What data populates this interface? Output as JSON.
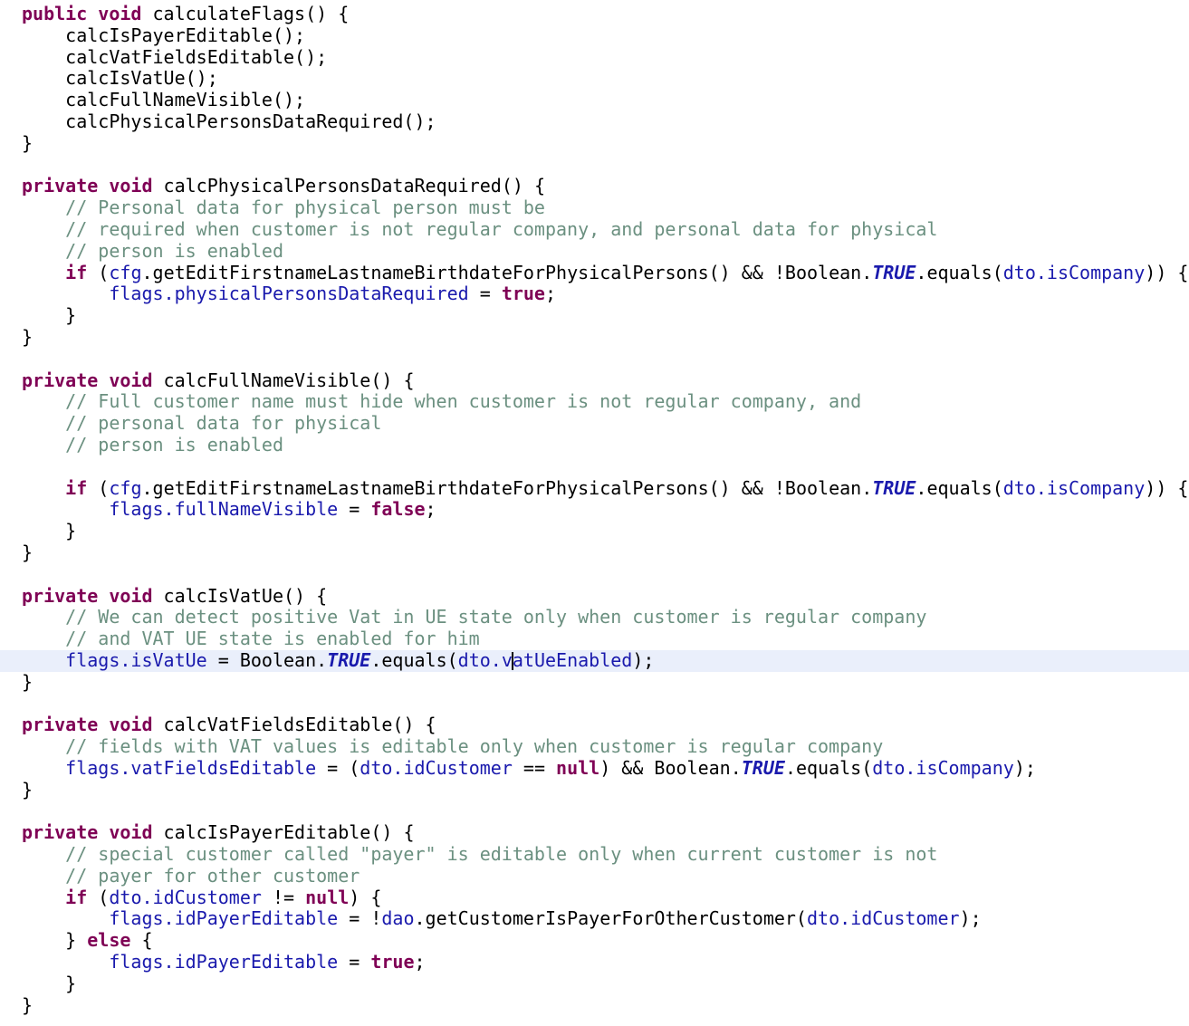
{
  "editor": {
    "language": "Java",
    "background_color": "#ffffff",
    "current_line_highlight_color": "#eaeffb",
    "caret_color": "#000000",
    "colors": {
      "plain": "#000000",
      "keyword": "#7f0055",
      "comment": "#6b9080",
      "field": "#1a1aad",
      "static_field": "#1a1aad"
    }
  },
  "code": {
    "lines": [
      {
        "current": false,
        "tokens": [
          {
            "t": "public",
            "c": "keyword"
          },
          {
            "t": " ",
            "c": "plain"
          },
          {
            "t": "void",
            "c": "keyword"
          },
          {
            "t": " calculateFlags() {",
            "c": "plain"
          }
        ]
      },
      {
        "current": false,
        "tokens": [
          {
            "t": "    calcIsPayerEditable();",
            "c": "plain"
          }
        ]
      },
      {
        "current": false,
        "tokens": [
          {
            "t": "    calcVatFieldsEditable();",
            "c": "plain"
          }
        ]
      },
      {
        "current": false,
        "tokens": [
          {
            "t": "    calcIsVatUe();",
            "c": "plain"
          }
        ]
      },
      {
        "current": false,
        "tokens": [
          {
            "t": "    calcFullNameVisible();",
            "c": "plain"
          }
        ]
      },
      {
        "current": false,
        "tokens": [
          {
            "t": "    calcPhysicalPersonsDataRequired();",
            "c": "plain"
          }
        ]
      },
      {
        "current": false,
        "tokens": [
          {
            "t": "}",
            "c": "plain"
          }
        ]
      },
      {
        "current": false,
        "tokens": []
      },
      {
        "current": false,
        "tokens": [
          {
            "t": "private",
            "c": "keyword"
          },
          {
            "t": " ",
            "c": "plain"
          },
          {
            "t": "void",
            "c": "keyword"
          },
          {
            "t": " calcPhysicalPersonsDataRequired() {",
            "c": "plain"
          }
        ]
      },
      {
        "current": false,
        "tokens": [
          {
            "t": "    // Personal data for physical person must be",
            "c": "comment"
          }
        ]
      },
      {
        "current": false,
        "tokens": [
          {
            "t": "    // required when customer is not regular company, and personal data for physical",
            "c": "comment"
          }
        ]
      },
      {
        "current": false,
        "tokens": [
          {
            "t": "    // person is enabled",
            "c": "comment"
          }
        ]
      },
      {
        "current": false,
        "tokens": [
          {
            "t": "    ",
            "c": "plain"
          },
          {
            "t": "if",
            "c": "keyword"
          },
          {
            "t": " (",
            "c": "plain"
          },
          {
            "t": "cfg",
            "c": "field"
          },
          {
            "t": ".getEditFirstnameLastnameBirthdateForPhysicalPersons() && !Boolean.",
            "c": "plain"
          },
          {
            "t": "TRUE",
            "c": "static"
          },
          {
            "t": ".equals(",
            "c": "plain"
          },
          {
            "t": "dto.isCompany",
            "c": "field"
          },
          {
            "t": ")) {",
            "c": "plain"
          }
        ]
      },
      {
        "current": false,
        "tokens": [
          {
            "t": "        ",
            "c": "plain"
          },
          {
            "t": "flags.physicalPersonsDataRequired",
            "c": "field"
          },
          {
            "t": " = ",
            "c": "plain"
          },
          {
            "t": "true",
            "c": "keyword"
          },
          {
            "t": ";",
            "c": "plain"
          }
        ]
      },
      {
        "current": false,
        "tokens": [
          {
            "t": "    }",
            "c": "plain"
          }
        ]
      },
      {
        "current": false,
        "tokens": [
          {
            "t": "}",
            "c": "plain"
          }
        ]
      },
      {
        "current": false,
        "tokens": []
      },
      {
        "current": false,
        "tokens": [
          {
            "t": "private",
            "c": "keyword"
          },
          {
            "t": " ",
            "c": "plain"
          },
          {
            "t": "void",
            "c": "keyword"
          },
          {
            "t": " calcFullNameVisible() {",
            "c": "plain"
          }
        ]
      },
      {
        "current": false,
        "tokens": [
          {
            "t": "    // Full customer name must hide when customer is not regular company, and",
            "c": "comment"
          }
        ]
      },
      {
        "current": false,
        "tokens": [
          {
            "t": "    // personal data for physical",
            "c": "comment"
          }
        ]
      },
      {
        "current": false,
        "tokens": [
          {
            "t": "    // person is enabled",
            "c": "comment"
          }
        ]
      },
      {
        "current": false,
        "tokens": []
      },
      {
        "current": false,
        "tokens": [
          {
            "t": "    ",
            "c": "plain"
          },
          {
            "t": "if",
            "c": "keyword"
          },
          {
            "t": " (",
            "c": "plain"
          },
          {
            "t": "cfg",
            "c": "field"
          },
          {
            "t": ".getEditFirstnameLastnameBirthdateForPhysicalPersons() && !Boolean.",
            "c": "plain"
          },
          {
            "t": "TRUE",
            "c": "static"
          },
          {
            "t": ".equals(",
            "c": "plain"
          },
          {
            "t": "dto.isCompany",
            "c": "field"
          },
          {
            "t": ")) {",
            "c": "plain"
          }
        ]
      },
      {
        "current": false,
        "tokens": [
          {
            "t": "        ",
            "c": "plain"
          },
          {
            "t": "flags.fullNameVisible",
            "c": "field"
          },
          {
            "t": " = ",
            "c": "plain"
          },
          {
            "t": "false",
            "c": "keyword"
          },
          {
            "t": ";",
            "c": "plain"
          }
        ]
      },
      {
        "current": false,
        "tokens": [
          {
            "t": "    }",
            "c": "plain"
          }
        ]
      },
      {
        "current": false,
        "tokens": [
          {
            "t": "}",
            "c": "plain"
          }
        ]
      },
      {
        "current": false,
        "tokens": []
      },
      {
        "current": false,
        "tokens": [
          {
            "t": "private",
            "c": "keyword"
          },
          {
            "t": " ",
            "c": "plain"
          },
          {
            "t": "void",
            "c": "keyword"
          },
          {
            "t": " calcIsVatUe() {",
            "c": "plain"
          }
        ]
      },
      {
        "current": false,
        "tokens": [
          {
            "t": "    // We can detect positive Vat in UE state only when customer is regular company",
            "c": "comment"
          }
        ]
      },
      {
        "current": false,
        "tokens": [
          {
            "t": "    // and VAT UE state is enabled for him",
            "c": "comment"
          }
        ]
      },
      {
        "current": true,
        "caret_after": 4,
        "tokens": [
          {
            "t": "    ",
            "c": "plain"
          },
          {
            "t": "flags.isVatUe",
            "c": "field"
          },
          {
            "t": " = Boolean.",
            "c": "plain"
          },
          {
            "t": "TRUE",
            "c": "static"
          },
          {
            "t": ".equals(",
            "c": "plain"
          },
          {
            "t": "dto.v",
            "c": "field"
          },
          {
            "t": "|CARET|",
            "c": "caret"
          },
          {
            "t": "atUeEnabled",
            "c": "field"
          },
          {
            "t": ");",
            "c": "plain"
          }
        ]
      },
      {
        "current": false,
        "tokens": [
          {
            "t": "}",
            "c": "plain"
          }
        ]
      },
      {
        "current": false,
        "tokens": []
      },
      {
        "current": false,
        "tokens": [
          {
            "t": "private",
            "c": "keyword"
          },
          {
            "t": " ",
            "c": "plain"
          },
          {
            "t": "void",
            "c": "keyword"
          },
          {
            "t": " calcVatFieldsEditable() {",
            "c": "plain"
          }
        ]
      },
      {
        "current": false,
        "tokens": [
          {
            "t": "    // fields with VAT values is editable only when customer is regular company",
            "c": "comment"
          }
        ]
      },
      {
        "current": false,
        "tokens": [
          {
            "t": "    ",
            "c": "plain"
          },
          {
            "t": "flags.vatFieldsEditable",
            "c": "field"
          },
          {
            "t": " = (",
            "c": "plain"
          },
          {
            "t": "dto.idCustomer",
            "c": "field"
          },
          {
            "t": " == ",
            "c": "plain"
          },
          {
            "t": "null",
            "c": "keyword"
          },
          {
            "t": ") && Boolean.",
            "c": "plain"
          },
          {
            "t": "TRUE",
            "c": "static"
          },
          {
            "t": ".equals(",
            "c": "plain"
          },
          {
            "t": "dto.isCompany",
            "c": "field"
          },
          {
            "t": ");",
            "c": "plain"
          }
        ]
      },
      {
        "current": false,
        "tokens": [
          {
            "t": "}",
            "c": "plain"
          }
        ]
      },
      {
        "current": false,
        "tokens": []
      },
      {
        "current": false,
        "tokens": [
          {
            "t": "private",
            "c": "keyword"
          },
          {
            "t": " ",
            "c": "plain"
          },
          {
            "t": "void",
            "c": "keyword"
          },
          {
            "t": " calcIsPayerEditable() {",
            "c": "plain"
          }
        ]
      },
      {
        "current": false,
        "tokens": [
          {
            "t": "    // special customer called \"payer\" is editable only when current customer is not",
            "c": "comment"
          }
        ]
      },
      {
        "current": false,
        "tokens": [
          {
            "t": "    // payer for other customer",
            "c": "comment"
          }
        ]
      },
      {
        "current": false,
        "tokens": [
          {
            "t": "    ",
            "c": "plain"
          },
          {
            "t": "if",
            "c": "keyword"
          },
          {
            "t": " (",
            "c": "plain"
          },
          {
            "t": "dto.idCustomer",
            "c": "field"
          },
          {
            "t": " != ",
            "c": "plain"
          },
          {
            "t": "null",
            "c": "keyword"
          },
          {
            "t": ") {",
            "c": "plain"
          }
        ]
      },
      {
        "current": false,
        "tokens": [
          {
            "t": "        ",
            "c": "plain"
          },
          {
            "t": "flags.idPayerEditable",
            "c": "field"
          },
          {
            "t": " = !",
            "c": "plain"
          },
          {
            "t": "dao",
            "c": "field"
          },
          {
            "t": ".getCustomerIsPayerForOtherCustomer(",
            "c": "plain"
          },
          {
            "t": "dto.idCustomer",
            "c": "field"
          },
          {
            "t": ");",
            "c": "plain"
          }
        ]
      },
      {
        "current": false,
        "tokens": [
          {
            "t": "    } ",
            "c": "plain"
          },
          {
            "t": "else",
            "c": "keyword"
          },
          {
            "t": " {",
            "c": "plain"
          }
        ]
      },
      {
        "current": false,
        "tokens": [
          {
            "t": "        ",
            "c": "plain"
          },
          {
            "t": "flags.idPayerEditable",
            "c": "field"
          },
          {
            "t": " = ",
            "c": "plain"
          },
          {
            "t": "true",
            "c": "keyword"
          },
          {
            "t": ";",
            "c": "plain"
          }
        ]
      },
      {
        "current": false,
        "tokens": [
          {
            "t": "    }",
            "c": "plain"
          }
        ]
      },
      {
        "current": false,
        "tokens": [
          {
            "t": "}",
            "c": "plain"
          }
        ]
      }
    ]
  }
}
